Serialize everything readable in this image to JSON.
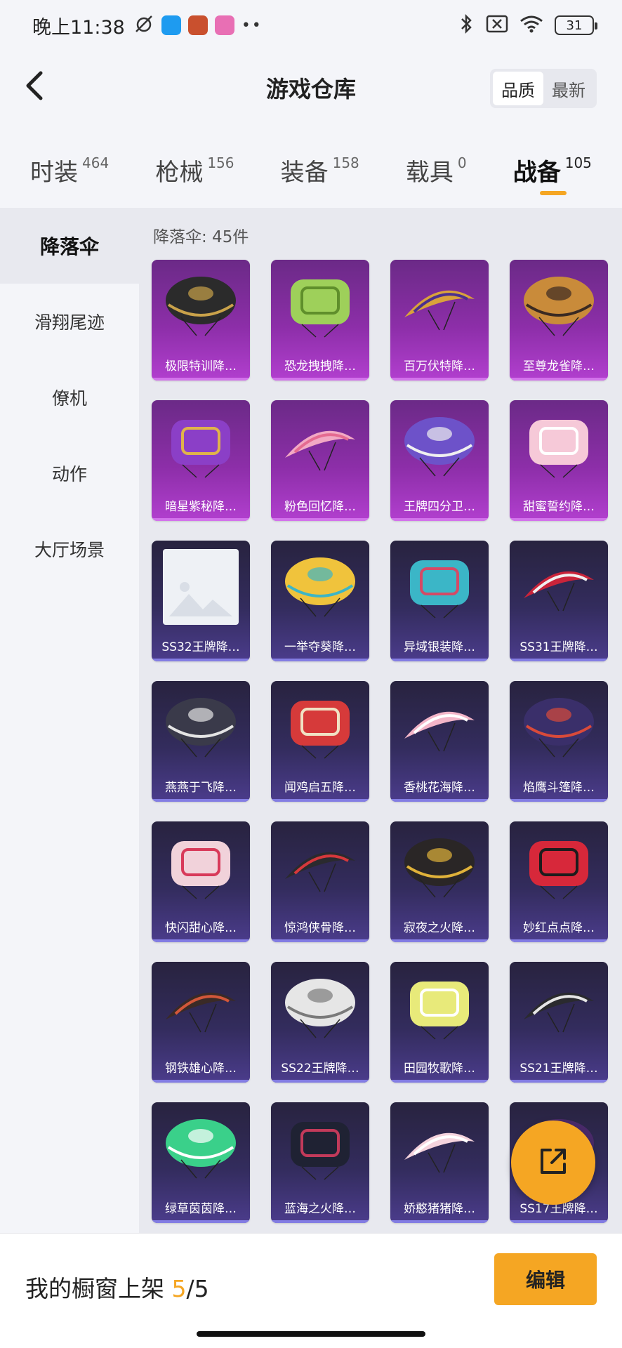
{
  "status_bar": {
    "time": "晚上11:38",
    "battery": "31"
  },
  "header": {
    "title": "游戏仓库",
    "sort_options": [
      "品质",
      "最新"
    ]
  },
  "category_tabs": [
    {
      "label": "时装",
      "count": "464"
    },
    {
      "label": "枪械",
      "count": "156"
    },
    {
      "label": "装备",
      "count": "158"
    },
    {
      "label": "载具",
      "count": "0"
    },
    {
      "label": "战备",
      "count": "105"
    }
  ],
  "side_nav": [
    "降落伞",
    "滑翔尾迹",
    "僚机",
    "动作",
    "大厅场景"
  ],
  "content": {
    "section_title": "降落伞: 45件",
    "items": [
      {
        "name": "极限特训降…",
        "rarity": "purple",
        "color": "#2b2b2b",
        "accent": "#c9a24a"
      },
      {
        "name": "恐龙拽拽降…",
        "rarity": "purple",
        "color": "#9ed05a",
        "accent": "#5f8f2b"
      },
      {
        "name": "百万伏特降…",
        "rarity": "purple",
        "color": "#d9a23b",
        "accent": "#4b2f8f"
      },
      {
        "name": "至尊龙雀降…",
        "rarity": "purple",
        "color": "#c98b3a",
        "accent": "#3a2a22"
      },
      {
        "name": "暗星紫秘降…",
        "rarity": "purple",
        "color": "#8b3fc7",
        "accent": "#e0b34a"
      },
      {
        "name": "粉色回忆降…",
        "rarity": "purple",
        "color": "#f2a9c4",
        "accent": "#e56b91"
      },
      {
        "name": "王牌四分卫…",
        "rarity": "purple",
        "color": "#6d52c9",
        "accent": "#f0f0f0"
      },
      {
        "name": "甜蜜誓约降…",
        "rarity": "purple",
        "color": "#f6c9d8",
        "accent": "#ffffff"
      },
      {
        "name": "SS32王牌降…",
        "rarity": "blue",
        "color": "placeholder",
        "accent": "#cccccc"
      },
      {
        "name": "一举夺葵降…",
        "rarity": "blue",
        "color": "#f0c33c",
        "accent": "#3db5c5"
      },
      {
        "name": "异域银装降…",
        "rarity": "blue",
        "color": "#3bb6c7",
        "accent": "#d44a66"
      },
      {
        "name": "SS31王牌降…",
        "rarity": "blue",
        "color": "#c9243a",
        "accent": "#f0f0f0"
      },
      {
        "name": "燕燕于飞降…",
        "rarity": "blue",
        "color": "#3a3a4a",
        "accent": "#e4e4e4"
      },
      {
        "name": "闻鸡启五降…",
        "rarity": "blue",
        "color": "#d63a3a",
        "accent": "#f0e2c4"
      },
      {
        "name": "香桃花海降…",
        "rarity": "blue",
        "color": "#f3b5c8",
        "accent": "#ffffff"
      },
      {
        "name": "焰鹰斗篷降…",
        "rarity": "blue",
        "color": "#3a2f6a",
        "accent": "#d94a3a"
      },
      {
        "name": "快闪甜心降…",
        "rarity": "blue",
        "color": "#f1d2da",
        "accent": "#d83a5a"
      },
      {
        "name": "惊鸿侠骨降…",
        "rarity": "blue",
        "color": "#2a2a2e",
        "accent": "#d6383c"
      },
      {
        "name": "寂夜之火降…",
        "rarity": "blue",
        "color": "#2a2626",
        "accent": "#e0b23a"
      },
      {
        "name": "妙红点点降…",
        "rarity": "blue",
        "color": "#d7283a",
        "accent": "#1c1c1c"
      },
      {
        "name": "钢铁雄心降…",
        "rarity": "blue",
        "color": "#3a2a26",
        "accent": "#d2573a"
      },
      {
        "name": "SS22王牌降…",
        "rarity": "blue",
        "color": "#e6e6e6",
        "accent": "#7a7a7a"
      },
      {
        "name": "田园牧歌降…",
        "rarity": "blue",
        "color": "#e8ea7a",
        "accent": "#ffffff"
      },
      {
        "name": "SS21王牌降…",
        "rarity": "blue",
        "color": "#2a2a2e",
        "accent": "#e6e6e6"
      },
      {
        "name": "绿草茵茵降…",
        "rarity": "blue",
        "color": "#3ad08a",
        "accent": "#ffffff"
      },
      {
        "name": "蓝海之火降…",
        "rarity": "blue",
        "color": "#1f2233",
        "accent": "#c23a5a"
      },
      {
        "name": "娇憨猪猪降…",
        "rarity": "blue",
        "color": "#f5d3dd",
        "accent": "#ffffff"
      },
      {
        "name": "SS17王牌降…",
        "rarity": "blue",
        "color": "#4a2a6a",
        "accent": "#e0e0e0"
      }
    ]
  },
  "bottom_bar": {
    "showcase_label": "我的橱窗上架",
    "showcase_current": "5",
    "showcase_sep_total": "/5",
    "edit_label": "编辑"
  },
  "colors": {
    "accent": "#f5a623",
    "purple_card": "#8c2ea8",
    "blue_card": "#332c5d"
  }
}
